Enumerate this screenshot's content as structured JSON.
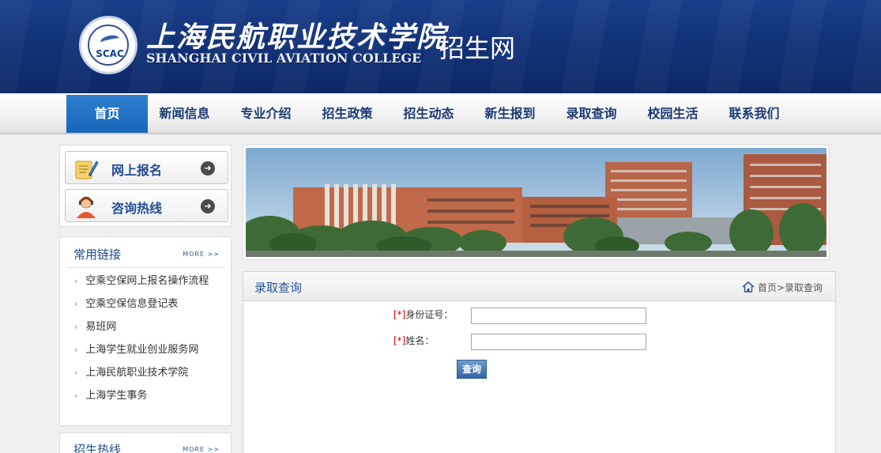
{
  "header": {
    "logo_text": "SCAC",
    "college_cn": "上海民航职业技术学院",
    "college_en": "SHANGHAI CIVIL AVIATION COLLEGE",
    "site_name": "招生网"
  },
  "nav": {
    "items": [
      {
        "label": "首页",
        "active": true
      },
      {
        "label": "新闻信息"
      },
      {
        "label": "专业介绍"
      },
      {
        "label": "招生政策"
      },
      {
        "label": "招生动态"
      },
      {
        "label": "新生报到"
      },
      {
        "label": "录取查询"
      },
      {
        "label": "校园生活"
      },
      {
        "label": "联系我们"
      }
    ]
  },
  "sidebar": {
    "buttons": [
      {
        "label": "网上报名"
      },
      {
        "label": "咨询热线"
      }
    ],
    "links_box": {
      "title": "常用链接",
      "more": "MORE >>",
      "items": [
        "空乘空保网上报名操作流程",
        "空乘空保信息登记表",
        "易班网",
        "上海学生就业创业服务网",
        "上海民航职业技术学院",
        "上海学生事务"
      ]
    },
    "hotline_box": {
      "title": "招生热线",
      "more": "MORE >>"
    }
  },
  "panel": {
    "title": "录取查询",
    "breadcrumb": "首页>录取查询",
    "form": {
      "required_mark": "[*]",
      "id_label": "身份证号：",
      "id_value": "",
      "name_label": "姓名：",
      "name_value": "",
      "submit_label": "查询"
    }
  },
  "colors": {
    "header_bg": "#123279",
    "nav_active": "#1667b8",
    "nav_text": "#1b3a73",
    "link_title": "#1d4b8e",
    "required": "#d40000"
  }
}
